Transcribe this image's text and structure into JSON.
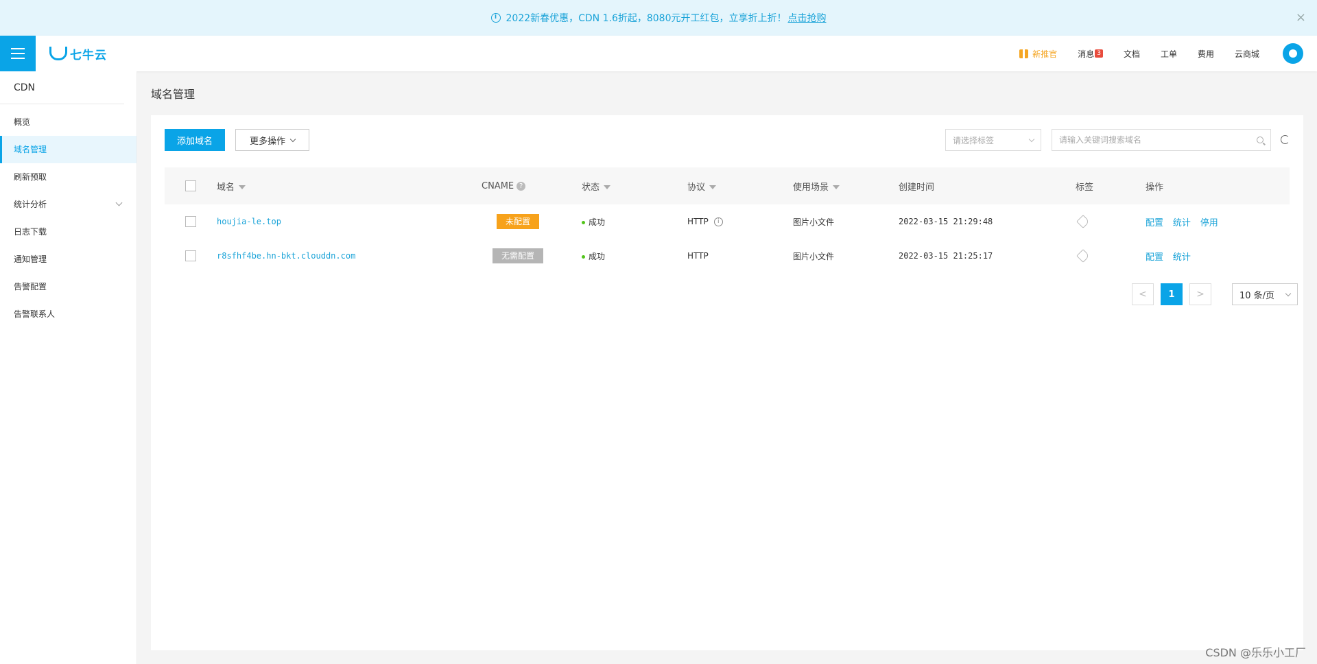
{
  "banner": {
    "text": "2022新春优惠，CDN 1.6折起，8080元开工红包，立享折上折！",
    "link": "点击抢购",
    "close": "×"
  },
  "topnav": {
    "logo": "七牛云",
    "promo": "新推官",
    "messages": "消息",
    "message_count": "3",
    "docs": "文档",
    "tickets": "工单",
    "billing": "费用",
    "mall": "云商城"
  },
  "sidebar": {
    "title": "CDN",
    "items": [
      {
        "label": "概览"
      },
      {
        "label": "域名管理"
      },
      {
        "label": "刷新预取"
      },
      {
        "label": "统计分析"
      },
      {
        "label": "日志下载"
      },
      {
        "label": "通知管理"
      },
      {
        "label": "告警配置"
      },
      {
        "label": "告警联系人"
      }
    ]
  },
  "main": {
    "title": "域名管理",
    "add_button": "添加域名",
    "more_button": "更多操作",
    "tag_select_placeholder": "请选择标签",
    "search_placeholder": "请输入关键词搜索域名"
  },
  "table": {
    "headers": {
      "domain": "域名",
      "cname": "CNAME",
      "status": "状态",
      "protocol": "协议",
      "scene": "使用场景",
      "created": "创建时间",
      "tag": "标签",
      "ops": "操作"
    },
    "rows": [
      {
        "domain": "houjia-le.top",
        "cname": "未配置",
        "status": "成功",
        "protocol": "HTTP",
        "scene": "图片小文件",
        "created": "2022-03-15 21:29:48",
        "op1": "配置",
        "op2": "统计",
        "op3": "停用"
      },
      {
        "domain": "r8sfhf4be.hn-bkt.clouddn.com",
        "cname": "无需配置",
        "status": "成功",
        "protocol": "HTTP",
        "scene": "图片小文件",
        "created": "2022-03-15 21:25:17",
        "op1": "配置",
        "op2": "统计"
      }
    ]
  },
  "pagination": {
    "prev": "<",
    "current": "1",
    "next": ">",
    "page_size": "10 条/页"
  },
  "watermark": "CSDN @乐乐小工厂",
  "colors": {
    "primary": "#0aa4e7",
    "warning": "#f7a21b",
    "success": "#52c41a"
  }
}
